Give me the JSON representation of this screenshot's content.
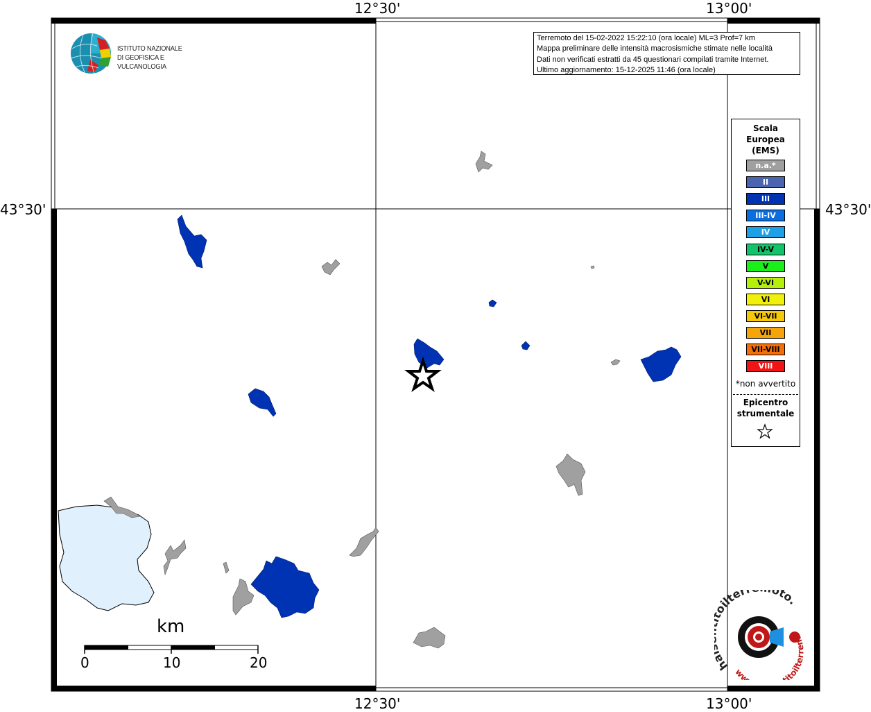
{
  "map": {
    "axis_labels": {
      "top": [
        "12°30'",
        "13°00'"
      ],
      "bottom": [
        "12°30'",
        "13°00'"
      ],
      "left": "43°30'",
      "right": "43°30'"
    },
    "info_lines": [
      "Terremoto del 15-02-2022 15:22:10 (ora locale) ML=3 Prof=7 km",
      "Mappa preliminare delle intensità macrosismiche stimate nelle località",
      "Dati non verificati estratti da 45 questionari compilati tramite Internet.",
      "Ultimo aggiornamento: 15-12-2025 11:46 (ora locale)"
    ],
    "colors": {
      "na": "#a0a0a0",
      "III": "#0033b3",
      "lake": "#e0f0fc"
    }
  },
  "logo_ingv": {
    "line1": "ISTITUTO NAZIONALE",
    "line2": "DI GEOFISICA E VULCANOLOGIA"
  },
  "legend": {
    "title_lines": [
      "Scala",
      "Europea",
      "(EMS)"
    ],
    "classes": [
      {
        "label": "n.a.*",
        "color": "#a0a0a0",
        "text_color": "#ffffff"
      },
      {
        "label": "II",
        "color": "#4a64b0",
        "text_color": "#ffffff"
      },
      {
        "label": "III",
        "color": "#0033b3",
        "text_color": "#ffffff"
      },
      {
        "label": "III-IV",
        "color": "#0a6ee0",
        "text_color": "#ffffff"
      },
      {
        "label": "IV",
        "color": "#1ea0e6",
        "text_color": "#ffffff"
      },
      {
        "label": "IV-V",
        "color": "#13c36a",
        "text_color": "#000000"
      },
      {
        "label": "V",
        "color": "#19f019",
        "text_color": "#000000"
      },
      {
        "label": "V-VI",
        "color": "#b4f00a",
        "text_color": "#000000"
      },
      {
        "label": "VI",
        "color": "#f0f00a",
        "text_color": "#000000"
      },
      {
        "label": "VI-VII",
        "color": "#f5c80a",
        "text_color": "#000000"
      },
      {
        "label": "VII",
        "color": "#f5a50a",
        "text_color": "#000000"
      },
      {
        "label": "VII-VIII",
        "color": "#f56e0a",
        "text_color": "#000000"
      },
      {
        "label": "VIII",
        "color": "#f01414",
        "text_color": "#ffffff"
      }
    ],
    "note": "*non avvertito",
    "epicenter_lines": [
      "Epicentro",
      "strumentale"
    ]
  },
  "scalebar": {
    "unit": "km",
    "ticks": [
      "0",
      "10",
      "20"
    ]
  },
  "hsit_logo": {
    "text_top": "haisentitoilterremoto.it",
    "text_bottom": "www.haisentitoilterremoto.it"
  }
}
